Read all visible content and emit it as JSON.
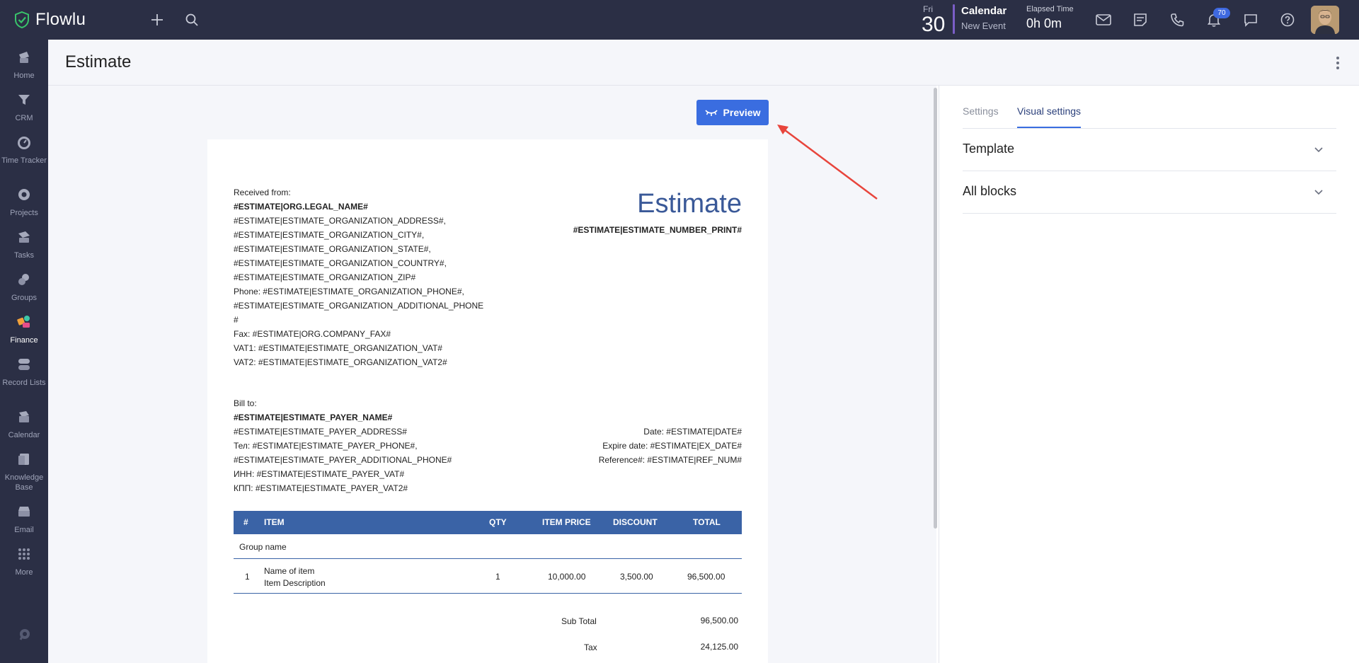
{
  "app": {
    "name": "Flowlu"
  },
  "topbar": {
    "date_day": "Fri",
    "date_num": "30",
    "calendar_title": "Calendar",
    "calendar_sub": "New Event",
    "elapsed_label": "Elapsed Time",
    "elapsed_value": "0h 0m",
    "notifications_count": "70"
  },
  "sidebar": {
    "items": [
      {
        "label": "Home",
        "icon": "home-icon"
      },
      {
        "label": "CRM",
        "icon": "crm-icon"
      },
      {
        "label": "Time Tracker",
        "icon": "timer-icon"
      },
      {
        "label": "Projects",
        "icon": "projects-icon"
      },
      {
        "label": "Tasks",
        "icon": "tasks-icon"
      },
      {
        "label": "Groups",
        "icon": "groups-icon"
      },
      {
        "label": "Finance",
        "icon": "finance-icon"
      },
      {
        "label": "Record Lists",
        "icon": "record-lists-icon"
      },
      {
        "label": "Calendar",
        "icon": "calendar-icon"
      },
      {
        "label": "Knowledge Base",
        "icon": "knowledge-base-icon"
      },
      {
        "label": "Email",
        "icon": "email-icon"
      },
      {
        "label": "More",
        "icon": "more-icon"
      }
    ]
  },
  "page": {
    "title": "Estimate"
  },
  "toolbar": {
    "preview_label": "Preview"
  },
  "doc": {
    "received_from": "Received from:",
    "org_name": "#ESTIMATE|ORG.LEGAL_NAME#",
    "org_lines": [
      "#ESTIMATE|ESTIMATE_ORGANIZATION_ADDRESS#,",
      "#ESTIMATE|ESTIMATE_ORGANIZATION_CITY#,",
      "#ESTIMATE|ESTIMATE_ORGANIZATION_STATE#,",
      "#ESTIMATE|ESTIMATE_ORGANIZATION_COUNTRY#,",
      "#ESTIMATE|ESTIMATE_ORGANIZATION_ZIP#",
      "Phone: #ESTIMATE|ESTIMATE_ORGANIZATION_PHONE#,",
      "#ESTIMATE|ESTIMATE_ORGANIZATION_ADDITIONAL_PHONE",
      "#",
      "Fax: #ESTIMATE|ORG.COMPANY_FAX#",
      "VAT1: #ESTIMATE|ESTIMATE_ORGANIZATION_VAT#",
      "VAT2: #ESTIMATE|ESTIMATE_ORGANIZATION_VAT2#"
    ],
    "title": "Estimate",
    "number": "#ESTIMATE|ESTIMATE_NUMBER_PRINT#",
    "bill_to": "Bill to:",
    "payer_name": "#ESTIMATE|ESTIMATE_PAYER_NAME#",
    "payer_lines": [
      "#ESTIMATE|ESTIMATE_PAYER_ADDRESS#",
      "Тел: #ESTIMATE|ESTIMATE_PAYER_PHONE#,",
      "#ESTIMATE|ESTIMATE_PAYER_ADDITIONAL_PHONE#",
      "ИНН: #ESTIMATE|ESTIMATE_PAYER_VAT#",
      "КПП: #ESTIMATE|ESTIMATE_PAYER_VAT2#"
    ],
    "date_line": "Date: #ESTIMATE|DATE#",
    "expire_line": "Expire date: #ESTIMATE|EX_DATE#",
    "reference_line": "Reference#: #ESTIMATE|REF_NUM#",
    "table": {
      "headers": [
        "#",
        "ITEM",
        "QTY",
        "ITEM PRICE",
        "DISCOUNT",
        "TOTAL"
      ],
      "group_name": "Group name",
      "row": {
        "num": "1",
        "name": "Name of item",
        "description": "Item Description",
        "qty": "1",
        "price": "10,000.00",
        "discount": "3,500.00",
        "total": "96,500.00"
      }
    },
    "subtotal_label": "Sub Total",
    "subtotal_value": "96,500.00",
    "tax_label": "Tax",
    "tax_value": "24,125.00"
  },
  "right_panel": {
    "tabs": [
      "Settings",
      "Visual settings"
    ],
    "active_tab": "Visual settings",
    "sections": [
      "Template",
      "All blocks"
    ]
  },
  "colors": {
    "nav_bg": "#2b2f45",
    "accent": "#3a6de0",
    "table_header": "#3a63a6",
    "doc_title": "#3a5998",
    "annotation_arrow": "#e8453c"
  }
}
